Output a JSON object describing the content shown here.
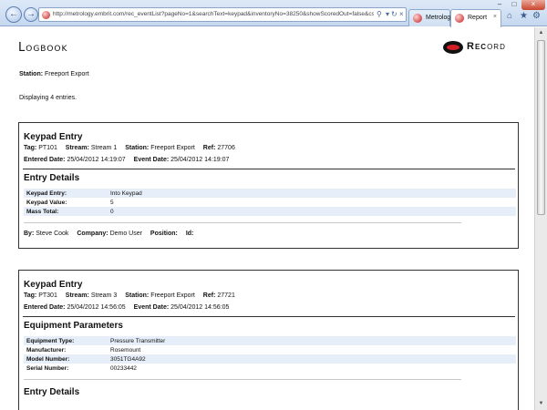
{
  "browser": {
    "url": "http://metrology.embrit.com/rec_eventList?pageNo=1&searchText=keypad&inventoryNo=38250&showScoredOut=false&csv",
    "tabs": [
      {
        "label": "Metrology",
        "active": false
      },
      {
        "label": "Report",
        "active": true
      }
    ],
    "accent_color": "#c5d8ef"
  },
  "header": {
    "logbook_logo": "Logbook",
    "record_logo_bold": "Rec",
    "record_logo_rest": "ord",
    "record_accent_color": "#d41f26"
  },
  "station": {
    "label": "Station:",
    "value": "Freeport Export"
  },
  "displaying": "Displaying 4 entries.",
  "entries": [
    {
      "title": "Keypad Entry",
      "tag_label": "Tag:",
      "tag": "PT101",
      "stream_label": "Stream:",
      "stream": "Stream 1",
      "station_label": "Station:",
      "station": "Freeport Export",
      "ref_label": "Ref:",
      "ref": "27706",
      "entered_label": "Entered Date:",
      "entered": "25/04/2012  14:19:07",
      "event_label": "Event Date:",
      "event": "25/04/2012  14:19:07",
      "details_title": "Entry Details",
      "details": [
        {
          "key": "Keypad Entry:",
          "value": "Into Keypad"
        },
        {
          "key": "Keypad Value:",
          "value": "5"
        },
        {
          "key": "Mass Total:",
          "value": "0"
        }
      ],
      "by_label": "By:",
      "by": "Steve Cook",
      "company_label": "Company:",
      "company": "Demo User",
      "position_label": "Position:",
      "position": "",
      "id_label": "Id:",
      "id": ""
    },
    {
      "title": "Keypad Entry",
      "tag_label": "Tag:",
      "tag": "PT301",
      "stream_label": "Stream:",
      "stream": "Stream 3",
      "station_label": "Station:",
      "station": "Freeport Export",
      "ref_label": "Ref:",
      "ref": "27721",
      "entered_label": "Entered Date:",
      "entered": "25/04/2012  14:56:05",
      "event_label": "Event Date:",
      "event": "25/04/2012  14:56:05",
      "params_title": "Equipment Parameters",
      "params": [
        {
          "key": "Equipment Type:",
          "value": "Pressure Transmitter"
        },
        {
          "key": "Manufacturer:",
          "value": "Rosemount"
        },
        {
          "key": "Model Number:",
          "value": "3051TG4A92"
        },
        {
          "key": "Serial Number:",
          "value": "00233442"
        }
      ],
      "details_title": "Entry Details"
    }
  ]
}
